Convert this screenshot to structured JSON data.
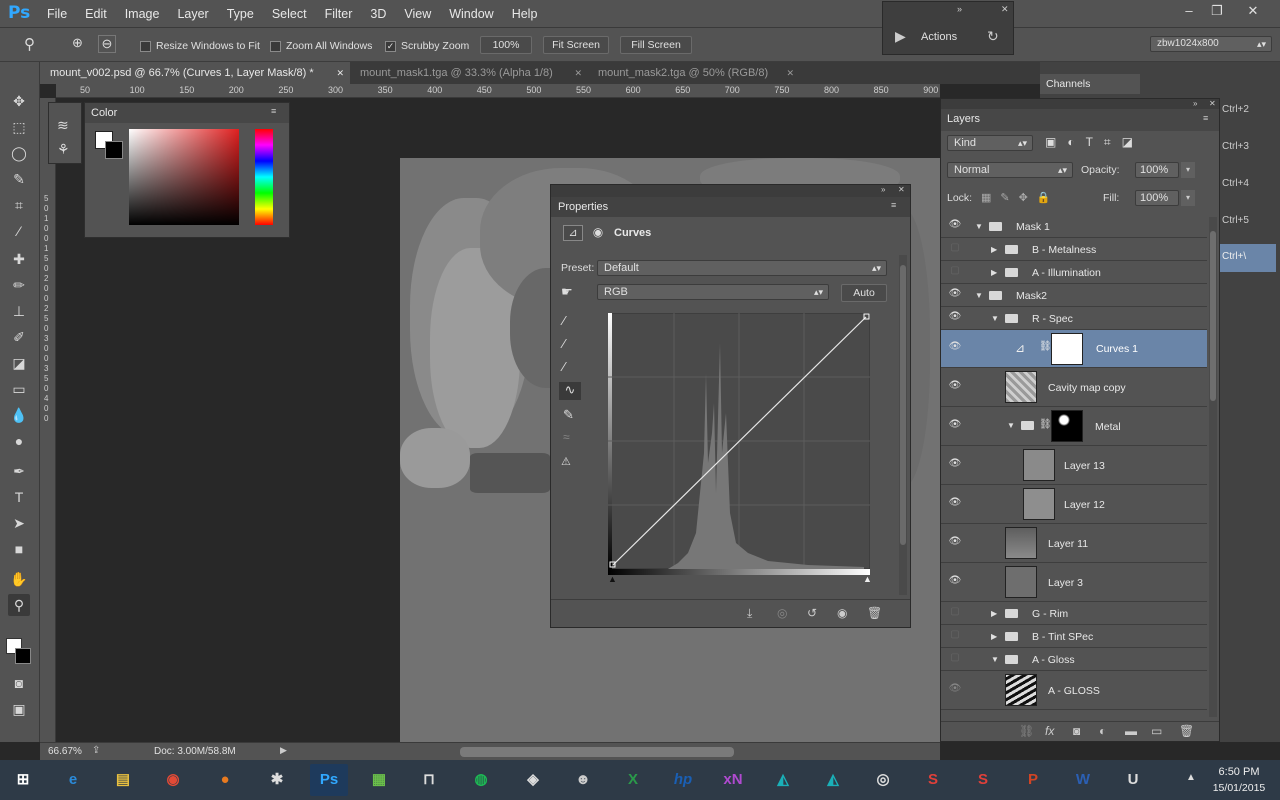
{
  "app": {
    "logo": "Ps",
    "menus": [
      "File",
      "Edit",
      "Image",
      "Layer",
      "Type",
      "Select",
      "Filter",
      "3D",
      "View",
      "Window",
      "Help"
    ]
  },
  "options_bar": {
    "resize_windows": "Resize Windows to Fit",
    "zoom_all": "Zoom All Windows",
    "scrubby_zoom": "Scrubby Zoom",
    "zoom_pct": "100%",
    "fit_screen": "Fit Screen",
    "fill_screen": "Fill Screen",
    "workspace": "zbw1024x800"
  },
  "actions_panel": {
    "label": "Actions"
  },
  "doc_tabs": [
    "mount_v002.psd @ 66.7% (Curves 1, Layer Mask/8) *",
    "mount_mask1.tga @ 33.3% (Alpha 1/8)",
    "mount_mask2.tga @ 50% (RGB/8)"
  ],
  "ruler": {
    "top": [
      "50",
      "100",
      "150",
      "200",
      "250",
      "300",
      "350",
      "400",
      "450",
      "500",
      "550",
      "600",
      "650",
      "700",
      "750",
      "800",
      "850",
      "900"
    ],
    "left": [
      "5",
      "0",
      "1",
      "0",
      "0",
      "1",
      "5",
      "0",
      "2",
      "0",
      "0",
      "2",
      "5",
      "0",
      "3",
      "0",
      "0",
      "3",
      "5",
      "0",
      "4",
      "0",
      "0"
    ]
  },
  "color_panel": {
    "title": "Color"
  },
  "properties": {
    "title": "Properties",
    "type": "Curves",
    "preset_label": "Preset:",
    "preset_value": "Default",
    "channel": "RGB",
    "auto": "Auto"
  },
  "channels_tab": "Channels",
  "shortcuts": [
    "Ctrl+2",
    "Ctrl+3",
    "Ctrl+4",
    "Ctrl+5",
    "Ctrl+\\"
  ],
  "layers_panel": {
    "title": "Layers",
    "kind": "Kind",
    "blend": "Normal",
    "opacity_label": "Opacity:",
    "opacity": "100%",
    "lock_label": "Lock:",
    "fill_label": "Fill:",
    "fill": "100%",
    "rows": [
      {
        "name": "Mask 1"
      },
      {
        "name": "B - Metalness"
      },
      {
        "name": "A - Illumination"
      },
      {
        "name": "Mask2"
      },
      {
        "name": "R - Spec"
      },
      {
        "name": "Curves 1"
      },
      {
        "name": "Cavity map copy"
      },
      {
        "name": "Metal"
      },
      {
        "name": "Layer 13"
      },
      {
        "name": "Layer 12"
      },
      {
        "name": "Layer 11"
      },
      {
        "name": "Layer 3"
      },
      {
        "name": "G - Rim"
      },
      {
        "name": "B - Tint SPec"
      },
      {
        "name": "A - Gloss"
      },
      {
        "name": "A - GLOSS"
      }
    ]
  },
  "status": {
    "zoom": "66.67%",
    "doc": "Doc: 3.00M/58.8M"
  },
  "taskbar": {
    "time": "6:50 PM",
    "date": "15/01/2015",
    "apps": [
      "e",
      "hp",
      "xN",
      "S",
      "S",
      "P",
      "W",
      "U"
    ]
  },
  "colors": {
    "accent": "#31a8ff",
    "selected_layer": "#6a85a8",
    "panel": "#535353"
  }
}
